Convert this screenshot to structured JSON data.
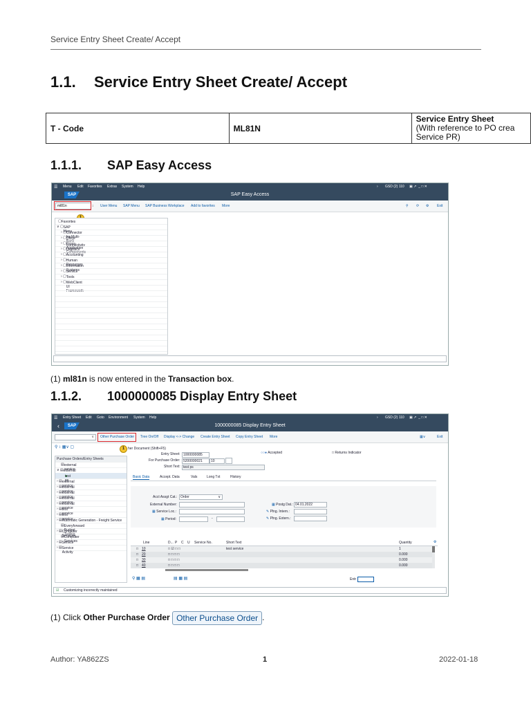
{
  "header": {
    "running_title": "Service Entry Sheet Create/ Accept"
  },
  "section": {
    "number": "1.1.",
    "title": "Service Entry Sheet Create/ Accept"
  },
  "tcode_table": {
    "label": "T - Code",
    "code": "ML81N",
    "desc_title": "Service Entry Sheet",
    "desc_line2": "(With reference to PO crea",
    "desc_line3": "Service PR)"
  },
  "sub1": {
    "number": "1.1.1.",
    "title": "SAP Easy Access"
  },
  "shot1": {
    "menu": [
      "Menu",
      "Edit",
      "Favorites",
      "Extras",
      "System",
      "Help"
    ],
    "menu_right": "GSD (2) 110",
    "logo": "SAP",
    "title": "SAP Easy Access",
    "command_value": "ml81n",
    "badge": "1",
    "toolbar": [
      "User Menu",
      "SAP Menu",
      "SAP Business Workplace",
      "Add to favorites",
      "More"
    ],
    "exit": "Exit",
    "tree": [
      "Favorites",
      "SAP Menu",
      "Connector for Multi-Bank Connectivity",
      "Office",
      "Cross-Application Components",
      "Logistics",
      "Accounting",
      "Human Resources",
      "Information Systems",
      "Service",
      "Tools",
      "WebClient UI Framework"
    ]
  },
  "caption1": {
    "prefix": "(1) ",
    "bold1": "ml81n",
    "mid": " is now entered in the ",
    "bold2": "Transaction box",
    "suffix": "."
  },
  "sub2": {
    "number": "1.1.2.",
    "title": "1000000085 Display Entry Sheet"
  },
  "shot2": {
    "menu": [
      "Entry Sheet",
      "Edit",
      "Goto",
      "Environment",
      "System",
      "Help"
    ],
    "menu_right": "GSD (2) 110",
    "logo": "SAP",
    "title": "1000000085 Display Entry Sheet",
    "toolbar": [
      "Other Purchase Order",
      "Tree On/Off",
      "Display <-> Change",
      "Create Entry Sheet",
      "Copy Entry Sheet",
      "More"
    ],
    "exit": "Exit",
    "badge": "1",
    "other_doc": "her Document  (Shift+F5)",
    "entry_sheet_label": "Entry Sheet:",
    "entry_sheet_value": "1000000085",
    "po_label": "For Purchase Order:",
    "po_value": "5200000021",
    "po_item": "10",
    "short_text_label": "Short Text:",
    "short_text_value": "test ps",
    "accepted": "Accepted",
    "returns": "Returns Indicator",
    "left_header": "Purchase Orders/Entry Sheets",
    "left_items": [
      "external service",
      "external service",
      "test ps",
      "external service",
      "external service",
      "external service",
      "external service",
      "external service",
      "test service",
      "test service",
      "Automatic Generation - Freight Service",
      "Everyforward Budget Testing",
      "Computer Services",
      "Computer Services",
      "Service",
      "Service Activity"
    ],
    "tabs": [
      "Basic Data",
      "Accept. Data",
      "Vals",
      "Long Txt",
      "History"
    ],
    "acct_label": "Acct Assgt Cat.:",
    "acct_value": "Order",
    "ext_num_label": "External Number:",
    "service_loc_label": "Service Loc.:",
    "period_label": "Period:",
    "posting_label": "Postg Dat.:",
    "posting_value": "04.01.2022",
    "plng_intern": "Plng. Intern.:",
    "plng_extern": "Plng. Extern.:",
    "grid_headers": [
      "Line",
      "D...",
      "P",
      "C",
      "U",
      "Service No.",
      "Short Text",
      "Quantity"
    ],
    "grid_rows": [
      {
        "line": "10",
        "text": "test service",
        "qty": "1"
      },
      {
        "line": "20",
        "text": "",
        "qty": "0.000"
      },
      {
        "line": "30",
        "text": "",
        "qty": "0.000"
      },
      {
        "line": "40",
        "text": "",
        "qty": "0.000"
      }
    ],
    "entry_label": "Entr",
    "status": "Customizing incorrectly maintained"
  },
  "caption2": {
    "prefix": "(1) Click ",
    "bold": "Other Purchase Order",
    "button": "Other Purchase Order",
    "suffix": "."
  },
  "footer": {
    "author": "Author: YA862ZS",
    "page": "1",
    "date": "2022-01-18"
  }
}
